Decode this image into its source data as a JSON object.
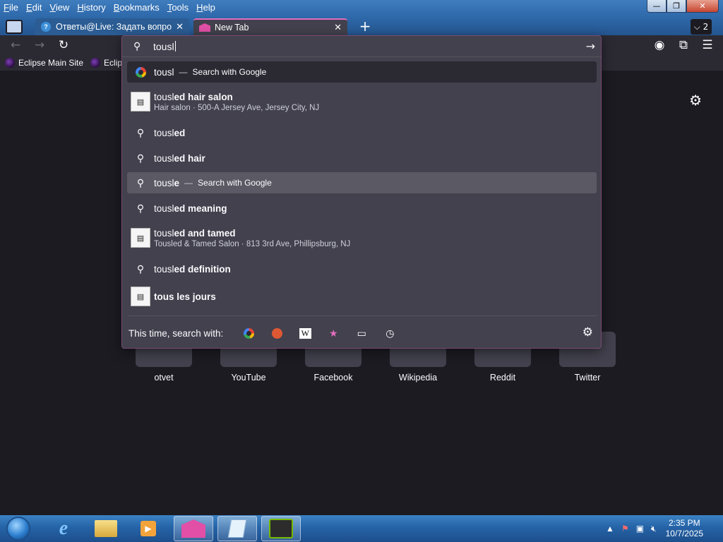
{
  "menu": [
    "File",
    "Edit",
    "View",
    "History",
    "Bookmarks",
    "Tools",
    "Help"
  ],
  "window_buttons": {
    "minimize": "—",
    "restore": "❐",
    "close": "✕"
  },
  "tabs": [
    {
      "title": "Ответы@Live: Задать вопрос",
      "close": "✕"
    },
    {
      "title": "New Tab",
      "close": "✕"
    }
  ],
  "new_tab": "+",
  "tab_list_count": "2",
  "bookmarks": [
    "Eclipse Main Site",
    "Eclips"
  ],
  "urlbar": {
    "typed": "tousl"
  },
  "suggestions": [
    {
      "type": "search-engine",
      "typed": "tousl",
      "rest": "",
      "action": "Search with Google"
    },
    {
      "type": "place",
      "typed": "tousl",
      "rest": "ed hair salon",
      "sub": "Hair salon · 500-A Jersey Ave, Jersey City, NJ"
    },
    {
      "type": "search",
      "typed": "tousl",
      "rest": "ed"
    },
    {
      "type": "search",
      "typed": "tousl",
      "rest": "ed hair"
    },
    {
      "type": "search-engine",
      "typed": "tousl",
      "rest": "e",
      "action": "Search with Google"
    },
    {
      "type": "search",
      "typed": "tousl",
      "rest": "ed meaning"
    },
    {
      "type": "place",
      "typed": "tousl",
      "rest": "ed and tamed",
      "sub": "Tousled & Tamed Salon · 813 3rd Ave, Phillipsburg, NJ"
    },
    {
      "type": "search",
      "typed": "tousl",
      "rest": "ed definition"
    },
    {
      "type": "place",
      "typed": "",
      "rest": "tous les jours"
    }
  ],
  "search_with_label": "This time, search with:",
  "search_engines": [
    "google-icon",
    "duckduckgo-icon",
    "wikipedia-icon",
    "bookmarks-icon",
    "tabs-icon",
    "history-icon"
  ],
  "top_sites": [
    "otvet",
    "YouTube",
    "Facebook",
    "Wikipedia",
    "Reddit",
    "Twitter"
  ],
  "clock": {
    "time": "2:35 PM",
    "date": "10/7/2025"
  },
  "colors": {
    "accent": "#e26dbc",
    "panel": "#42414d",
    "page": "#1c1b22"
  }
}
